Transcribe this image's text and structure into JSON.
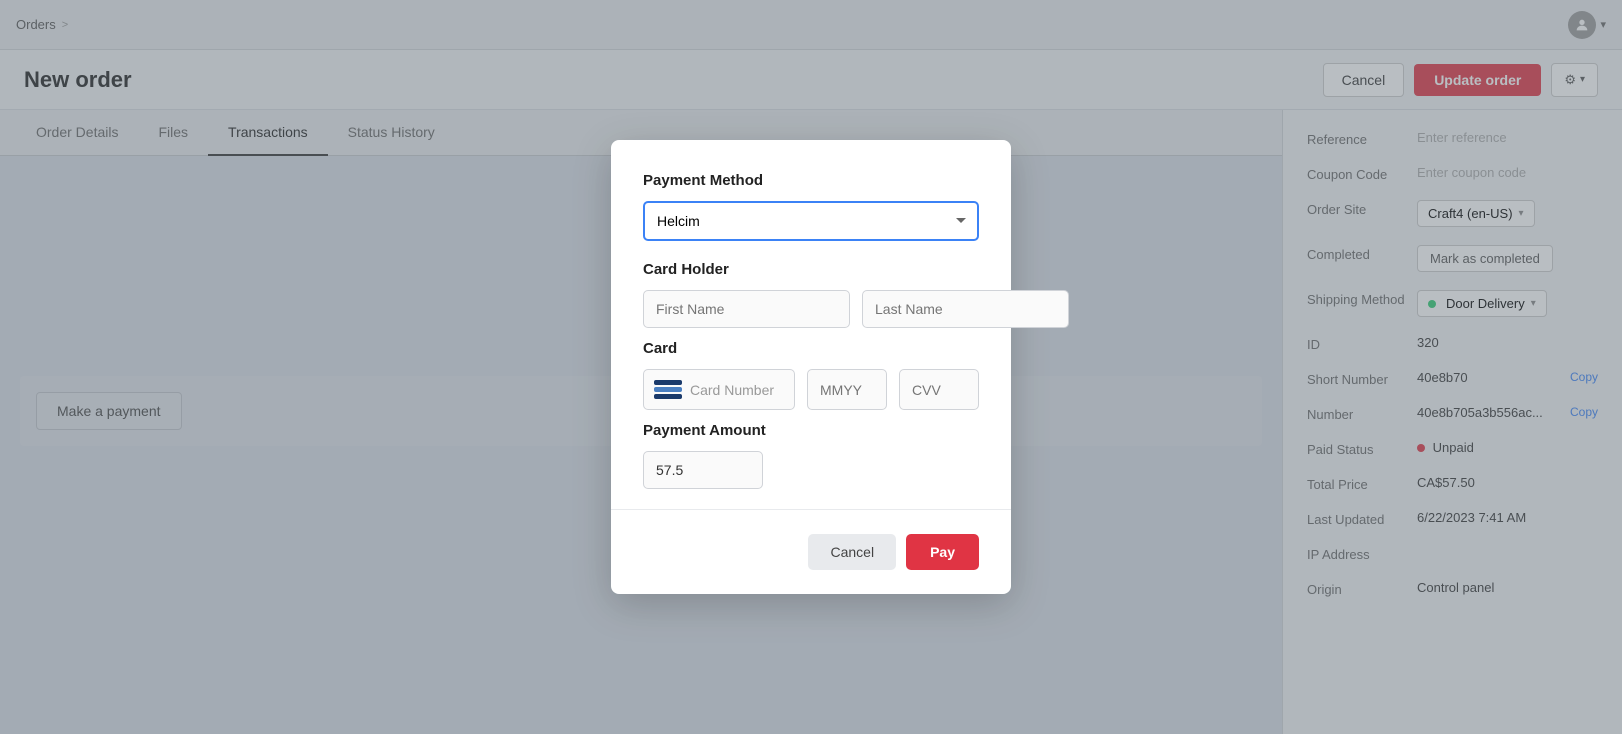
{
  "topbar": {
    "breadcrumb_orders": "Orders",
    "breadcrumb_sep": ">"
  },
  "header": {
    "title": "New order",
    "cancel_label": "Cancel",
    "update_label": "Update order",
    "gear_label": "⚙"
  },
  "tabs": [
    {
      "label": "Order Details",
      "active": false
    },
    {
      "label": "Files",
      "active": false
    },
    {
      "label": "Transactions",
      "active": true
    },
    {
      "label": "Status History",
      "active": false
    }
  ],
  "content": {
    "make_payment_label": "Make a payment"
  },
  "sidebar": {
    "reference_label": "Reference",
    "reference_placeholder": "Enter reference",
    "coupon_label": "Coupon Code",
    "coupon_placeholder": "Enter coupon code",
    "order_site_label": "Order Site",
    "order_site_value": "Craft4 (en-US)",
    "completed_label": "Completed",
    "completed_btn": "Mark as completed",
    "shipping_label": "Shipping Method",
    "shipping_value": "Door Delivery",
    "id_label": "ID",
    "id_value": "320",
    "short_number_label": "Short Number",
    "short_number_value": "40e8b70",
    "short_number_copy": "Copy",
    "number_label": "Number",
    "number_value": "40e8b705a3b556ac...",
    "number_copy": "Copy",
    "paid_status_label": "Paid Status",
    "paid_status_value": "Unpaid",
    "total_price_label": "Total Price",
    "total_price_value": "CA$57.50",
    "last_updated_label": "Last Updated",
    "last_updated_value": "6/22/2023 7:41 AM",
    "ip_label": "IP Address",
    "ip_value": "",
    "origin_label": "Origin",
    "origin_value": "Control panel"
  },
  "modal": {
    "title_payment_method": "Payment Method",
    "payment_method_selected": "Helcim",
    "payment_method_options": [
      "Helcim"
    ],
    "card_holder_label": "Card Holder",
    "first_name_placeholder": "First Name",
    "last_name_placeholder": "Last Name",
    "card_label": "Card",
    "card_number_placeholder": "Card Number",
    "mmyy_placeholder": "MMYY",
    "cvv_placeholder": "CVV",
    "payment_amount_label": "Payment Amount",
    "payment_amount_value": "57.5",
    "cancel_label": "Cancel",
    "pay_label": "Pay"
  }
}
